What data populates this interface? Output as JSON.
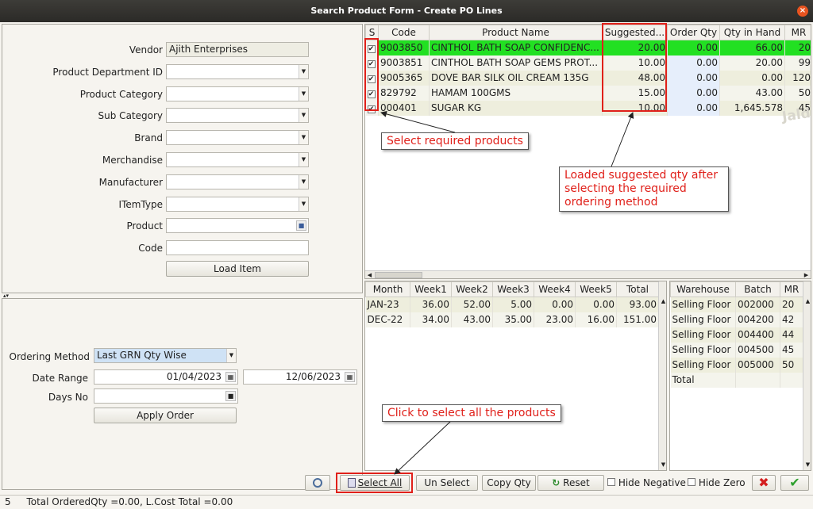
{
  "window": {
    "title": "Search Product Form - Create PO Lines",
    "close_glyph": "×"
  },
  "filters": [
    {
      "label": "Vendor",
      "value": "Ajith Enterprises",
      "kind": "text"
    },
    {
      "label": "Product Department ID",
      "value": "",
      "kind": "combo"
    },
    {
      "label": "Product Category",
      "value": "",
      "kind": "combo"
    },
    {
      "label": "Sub Category",
      "value": "",
      "kind": "combo"
    },
    {
      "label": "Brand",
      "value": "",
      "kind": "combo"
    },
    {
      "label": "Merchandise",
      "value": "",
      "kind": "combo"
    },
    {
      "label": "Manufacturer",
      "value": "",
      "kind": "combo"
    },
    {
      "label": "ITemType",
      "value": "",
      "kind": "combo"
    },
    {
      "label": "Product",
      "value": "",
      "kind": "lookup"
    },
    {
      "label": "Code",
      "value": "",
      "kind": "text"
    }
  ],
  "load_item_label": "Load Item",
  "ordering": {
    "method_label": "Ordering Method",
    "method_value": "Last GRN Qty Wise",
    "date_range_label": "Date Range",
    "date_from": "01/04/2023",
    "date_to": "12/06/2023",
    "days_label": "Days No",
    "days_value": "",
    "apply_label": "Apply Order"
  },
  "products": {
    "headers": [
      "S",
      "Code",
      "Product Name",
      "Suggested...",
      "Order Qty",
      "Qty in Hand",
      "MR"
    ],
    "rows": [
      {
        "code": "9003850",
        "name": "CINTHOL BATH SOAP CONFIDENC...",
        "suggested": "20.00",
        "order": "0.00",
        "hand": "66.00",
        "mr": "20"
      },
      {
        "code": "9003851",
        "name": "CINTHOL BATH SOAP GEMS PROT...",
        "suggested": "10.00",
        "order": "0.00",
        "hand": "20.00",
        "mr": "99"
      },
      {
        "code": "9005365",
        "name": "DOVE  BAR SILK OIL CREAM  135G",
        "suggested": "48.00",
        "order": "0.00",
        "hand": "0.00",
        "mr": "120"
      },
      {
        "code": "829792",
        "name": "HAMAM 100GMS",
        "suggested": "15.00",
        "order": "0.00",
        "hand": "43.00",
        "mr": "50"
      },
      {
        "code": "000401",
        "name": "SUGAR KG",
        "suggested": "10.00",
        "order": "0.00",
        "hand": "1,645.578",
        "mr": "45"
      }
    ]
  },
  "sales": {
    "headers": [
      "Month",
      "Week1",
      "Week2",
      "Week3",
      "Week4",
      "Week5",
      "Total"
    ],
    "rows": [
      [
        "JAN-23",
        "36.00",
        "52.00",
        "5.00",
        "0.00",
        "0.00",
        "93.00"
      ],
      [
        "DEC-22",
        "34.00",
        "43.00",
        "35.00",
        "23.00",
        "16.00",
        "151.00"
      ]
    ]
  },
  "stock": {
    "headers": [
      "Warehouse",
      "Batch",
      "MR"
    ],
    "rows": [
      [
        "Selling Floor",
        "002000",
        "20"
      ],
      [
        "Selling Floor",
        "004200",
        "42"
      ],
      [
        "Selling Floor",
        "004400",
        "44"
      ],
      [
        "Selling Floor",
        "004500",
        "45"
      ],
      [
        "Selling Floor",
        "005000",
        "50"
      ],
      [
        "Total",
        "",
        ""
      ]
    ]
  },
  "toolbar": {
    "select_all": "Select All",
    "un_select": "Un Select",
    "copy_qty": "Copy Qty",
    "reset": "Reset",
    "hide_negative": "Hide Negative",
    "hide_zero": "Hide Zero"
  },
  "status": {
    "count": "5",
    "summary": "Total OrderedQty =0.00, L.Cost Total =0.00"
  },
  "annotations": {
    "select_products": "Select required products",
    "suggested_qty": "Loaded suggested qty after selecting the required ordering method",
    "select_all_hint": "Click to select all the products"
  },
  "watermark": "Jaldi",
  "colors": {
    "highlight_row": "#22e022",
    "annotation_red": "#e0201a",
    "combo_blue": "#cfe2f5"
  }
}
